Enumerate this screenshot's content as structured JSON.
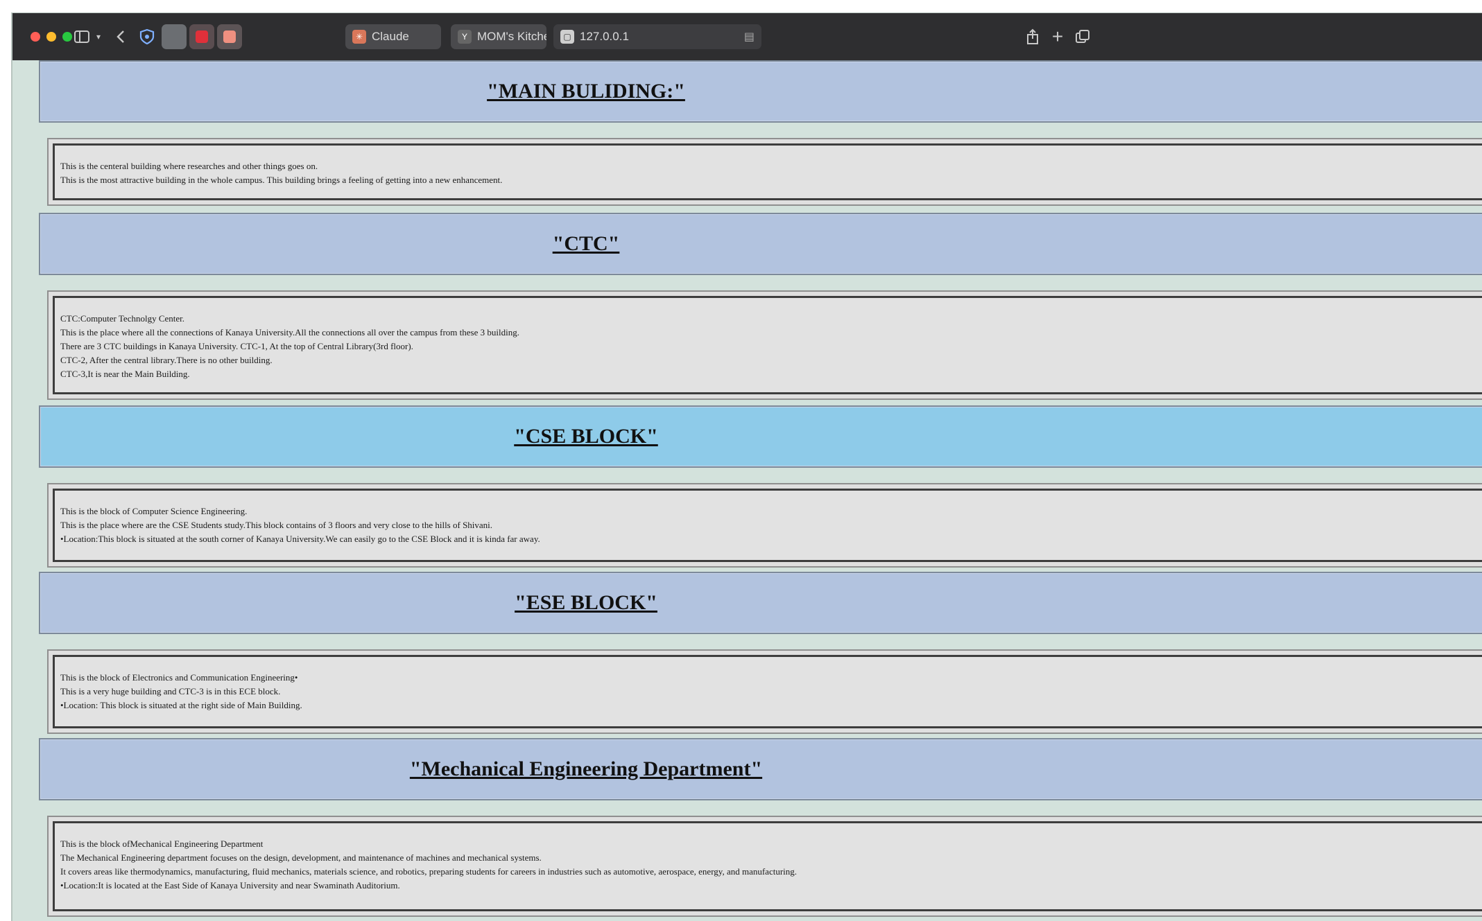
{
  "browser": {
    "tabs": [
      {
        "label": "Claude"
      },
      {
        "label": "MOM's Kitchen"
      },
      {
        "label": "127.0.0.1"
      }
    ]
  },
  "sections": [
    {
      "heading": "\"MAIN BULIDING:\"",
      "lines": [
        "This is the centeral building where researches and other things goes on.",
        "This is the most attractive building in the whole campus. This building brings a feeling of getting into a new enhancement."
      ]
    },
    {
      "heading": "\"CTC\"",
      "lines": [
        "CTC:Computer Technolgy Center.",
        "This is the place where all the connections of Kanaya University.All the connections all over the campus from these 3 building.",
        "There are 3 CTC buildings in Kanaya University. CTC-1, At the top of Central Library(3rd floor).",
        "CTC-2, After the central library.There is no other building.",
        "CTC-3,It is near the Main Building."
      ]
    },
    {
      "heading": "\"CSE BLOCK\"",
      "lines": [
        "This is the block of Computer Science Engineering.",
        "This is the place where are the CSE Students study.This block contains of 3 floors and very close to the hills of Shivani.",
        "•Location:This block is situated at the south corner of Kanaya University.We can easily go to the CSE Block and it is kinda far away."
      ]
    },
    {
      "heading": "\"ESE BLOCK\"",
      "lines": [
        "This is the block of Electronics and Communication Engineering•",
        "This is a very huge building and CTC-3 is in this ECE block.",
        "•Location: This block is situated at the right side of Main Building."
      ]
    },
    {
      "heading": "\"Mechanical Engineering Department\"",
      "lines": [
        "This is the block ofMechanical Engineering Department",
        "The Mechanical Engineering department focuses on the design, development, and maintenance of machines and mechanical systems.",
        "It covers areas like thermodynamics, manufacturing, fluid mechanics, materials science, and robotics, preparing students for careers in industries such as automotive, aerospace, energy, and manufacturing.",
        "•Location:It is located at the East Side of Kanaya University and near Swaminath Auditorium."
      ]
    }
  ]
}
